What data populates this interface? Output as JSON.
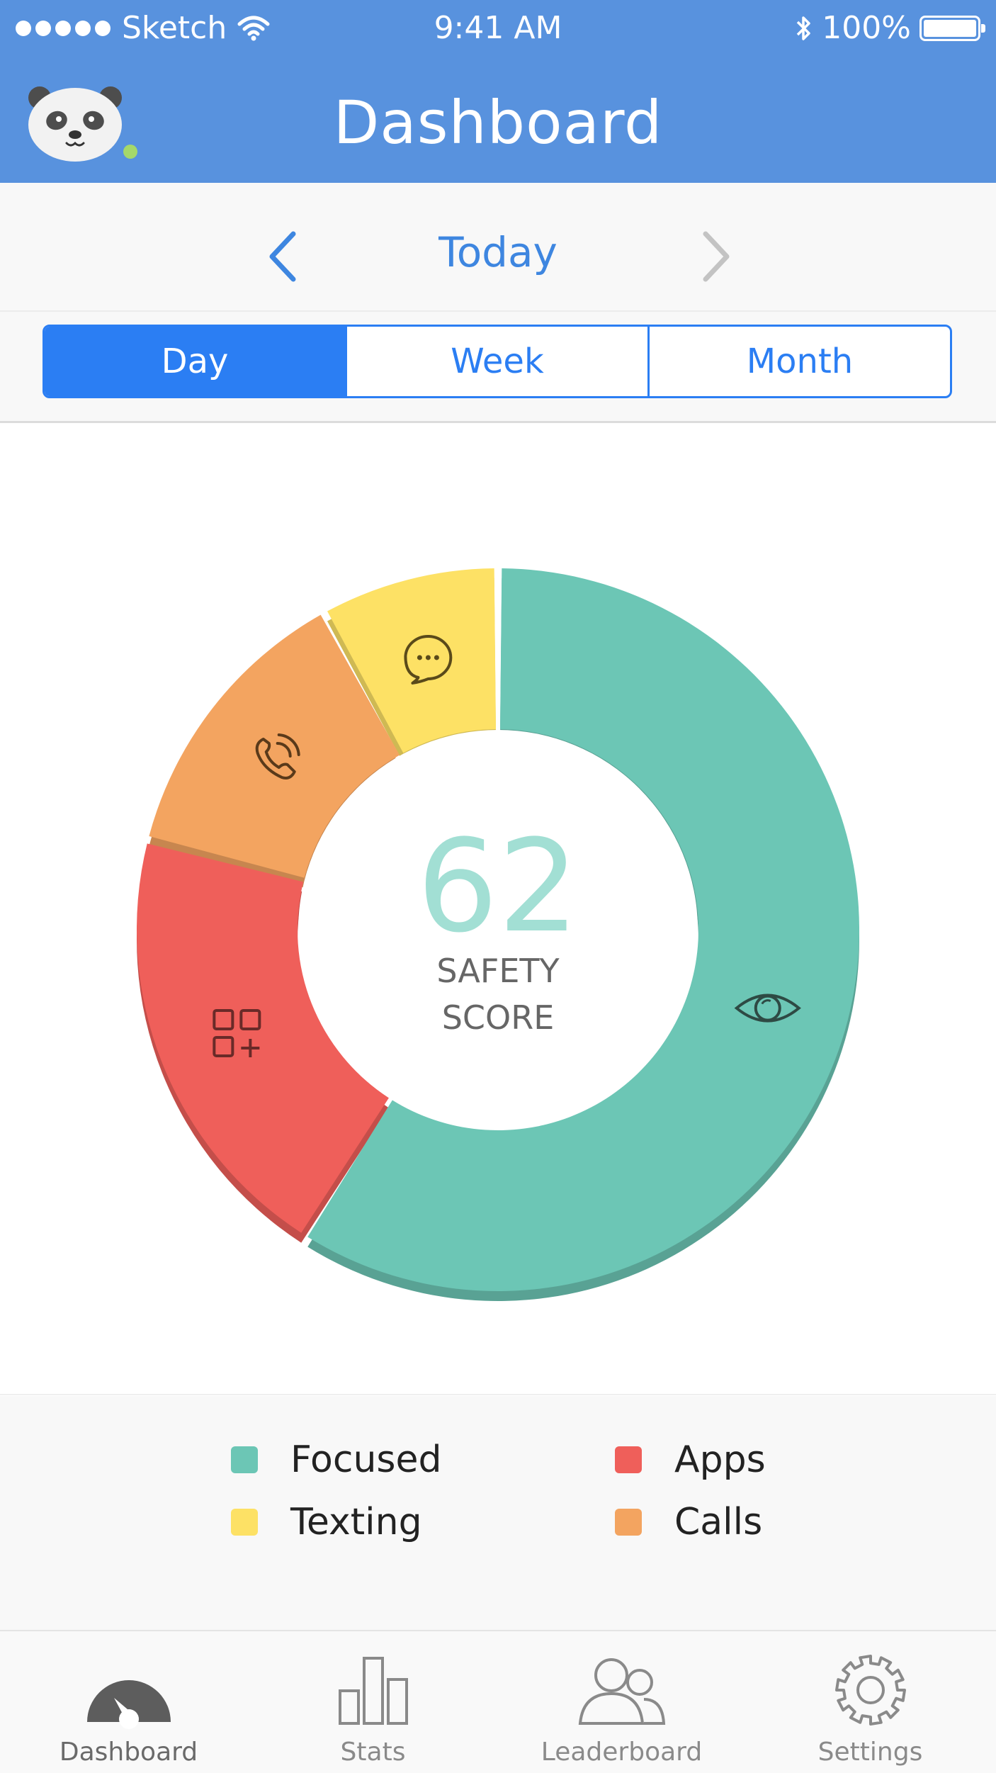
{
  "status_bar": {
    "carrier": "Sketch",
    "time": "9:41 AM",
    "battery": "100%"
  },
  "header": {
    "title": "Dashboard"
  },
  "date_nav": {
    "label": "Today"
  },
  "segments": [
    {
      "label": "Day",
      "active": true
    },
    {
      "label": "Week",
      "active": false
    },
    {
      "label": "Month",
      "active": false
    }
  ],
  "score": {
    "value": "62",
    "label_line1": "SAFETY",
    "label_line2": "SCORE"
  },
  "chart_data": {
    "type": "pie",
    "categories": [
      "Focused",
      "Apps",
      "Calls",
      "Texting"
    ],
    "values": [
      59,
      20,
      13,
      8
    ],
    "colors": [
      "#6cc6b5",
      "#ef5f5a",
      "#f3a460",
      "#fde165"
    ],
    "icons": [
      "eye-icon",
      "apps-icon",
      "phone-icon",
      "chat-icon"
    ]
  },
  "legend": [
    {
      "label": "Focused",
      "color": "#6cc6b5"
    },
    {
      "label": "Apps",
      "color": "#ef5f5a"
    },
    {
      "label": "Texting",
      "color": "#fde165"
    },
    {
      "label": "Calls",
      "color": "#f3a460"
    }
  ],
  "tabs": [
    {
      "label": "Dashboard",
      "icon": "gauge-icon",
      "active": true
    },
    {
      "label": "Stats",
      "icon": "bar-chart-icon",
      "active": false
    },
    {
      "label": "Leaderboard",
      "icon": "users-icon",
      "active": false
    },
    {
      "label": "Settings",
      "icon": "gear-icon",
      "active": false
    }
  ]
}
